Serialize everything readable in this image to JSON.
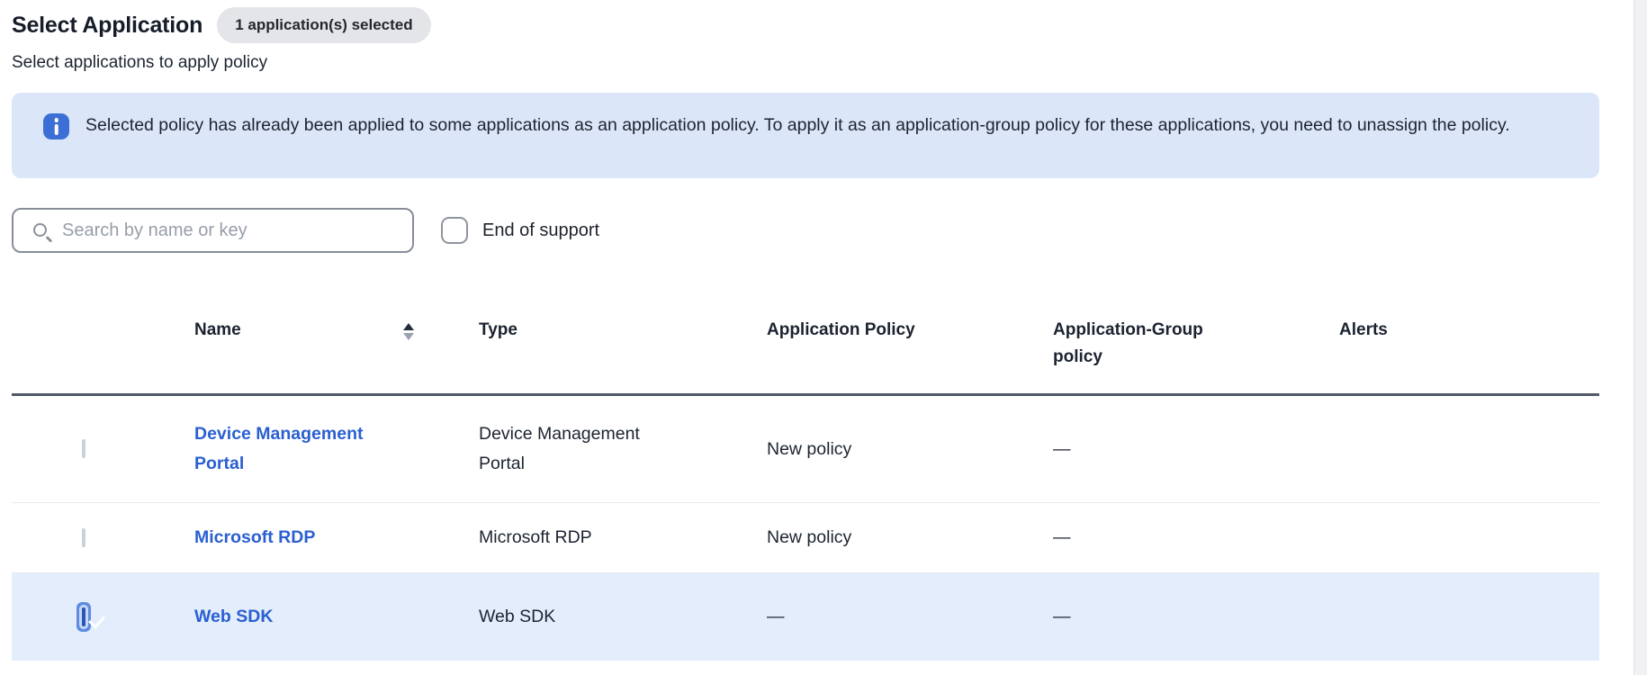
{
  "page": {
    "title": "Select Application",
    "selected_badge": "1 application(s) selected",
    "subtitle": "Select applications to apply policy"
  },
  "banner": {
    "icon": "info-icon",
    "text": "Selected policy has already been applied to some applications as an application policy. To apply it as an application-group policy for these applications, you need to unassign the policy."
  },
  "filters": {
    "search_placeholder": "Search by name or key",
    "end_of_support_label": "End of support",
    "end_of_support_checked": false
  },
  "table": {
    "select_all_state": "indeterminate",
    "sort": {
      "column": "Name",
      "direction": "asc"
    },
    "columns": {
      "name": "Name",
      "type": "Type",
      "application_policy": "Application Policy",
      "application_group_policy": "Application-Group policy",
      "alerts": "Alerts"
    },
    "rows": [
      {
        "name": "Device Management Portal",
        "type": "Device Management Portal",
        "application_policy": "New policy",
        "application_group_policy": "—",
        "alerts": "",
        "checked": false,
        "selected": false
      },
      {
        "name": "Microsoft RDP",
        "type": "Microsoft RDP",
        "application_policy": "New policy",
        "application_group_policy": "—",
        "alerts": "",
        "checked": false,
        "selected": false
      },
      {
        "name": "Web SDK",
        "type": "Web SDK",
        "application_policy": "—",
        "application_group_policy": "—",
        "alerts": "",
        "checked": true,
        "selected": true
      }
    ]
  },
  "colors": {
    "accent_blue": "#3b6fd6",
    "link_blue": "#2a5fd1",
    "banner_background": "#dbe7f9",
    "selected_row_background": "#e3edfb",
    "badge_background": "#e4e5e8",
    "header_divider": "#515a66"
  }
}
